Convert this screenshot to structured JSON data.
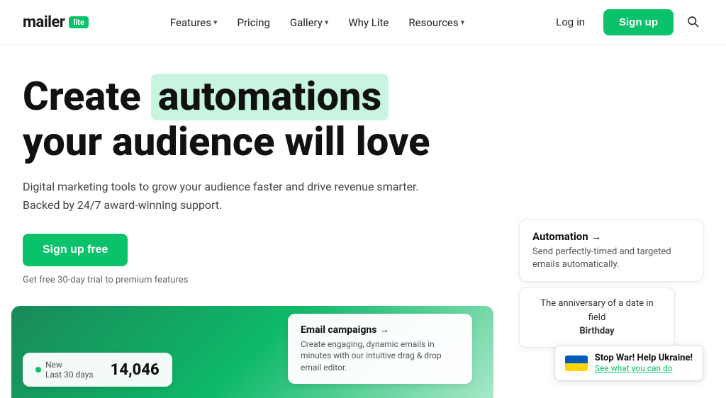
{
  "logo": {
    "text": "mailer",
    "badge": "lite"
  },
  "nav": {
    "links": [
      {
        "label": "Features",
        "hasDropdown": true
      },
      {
        "label": "Pricing",
        "hasDropdown": false
      },
      {
        "label": "Gallery",
        "hasDropdown": true
      },
      {
        "label": "Why Lite",
        "hasDropdown": false
      },
      {
        "label": "Resources",
        "hasDropdown": true
      }
    ],
    "login": "Log in",
    "signup": "Sign up"
  },
  "hero": {
    "title_prefix": "Create",
    "title_highlight": "automations",
    "title_suffix": "your audience will love",
    "subtitle": "Digital marketing tools to grow your audience faster and drive revenue smarter. Backed by 24/7 award-winning support.",
    "cta_button": "Sign up free",
    "trial_text": "Get free 30-day trial to premium features"
  },
  "automation_card": {
    "title": "Automation →",
    "description": "Send perfectly-timed and targeted emails automatically."
  },
  "anniversary_card": {
    "text": "The anniversary of a date in field",
    "bold": "Birthday"
  },
  "stats": {
    "label": "New",
    "sublabel": "Last 30 days",
    "value": "14,046"
  },
  "email_campaigns": {
    "title": "Email campaigns →",
    "description": "Create engaging, dynamic emails in minutes with our intuitive drag & drop email editor."
  },
  "stop_war": {
    "title": "Stop War! Help Ukraine!",
    "link": "See what you can do"
  }
}
